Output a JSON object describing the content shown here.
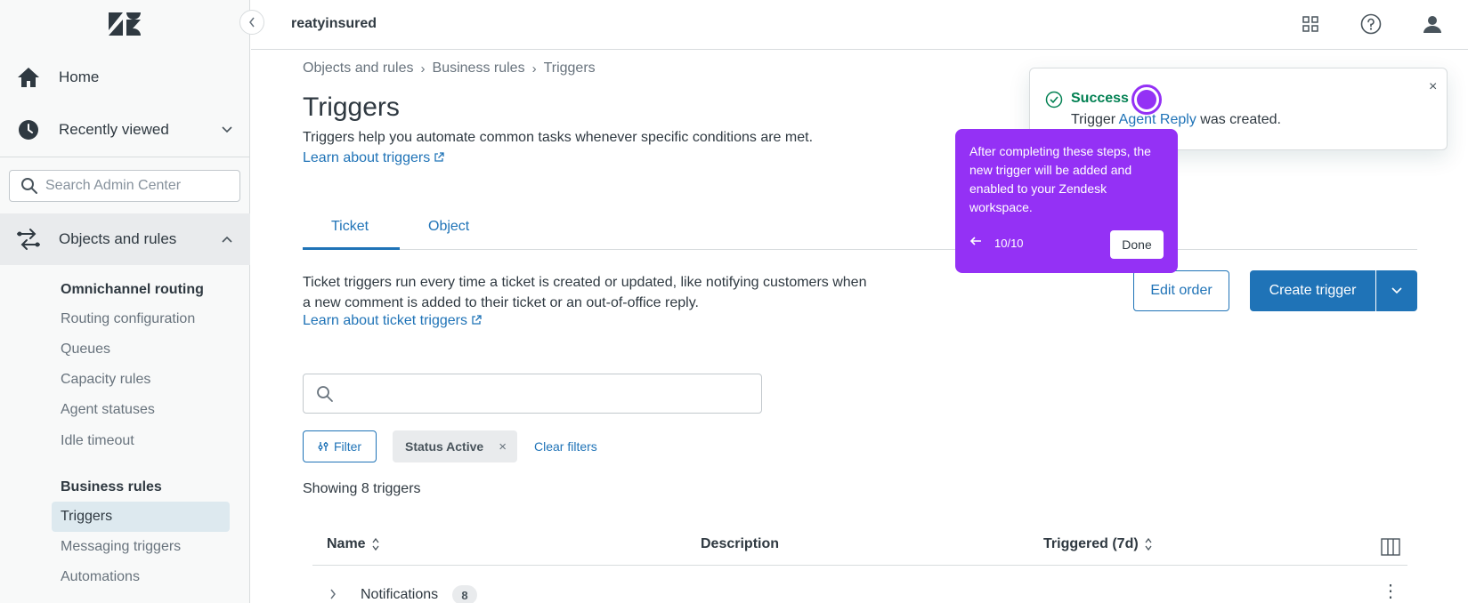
{
  "header": {
    "account_name": "reatyinsured"
  },
  "sidebar": {
    "home_label": "Home",
    "recently_viewed_label": "Recently viewed",
    "search_placeholder": "Search Admin Center",
    "objects_rules_label": "Objects and rules",
    "sections": [
      {
        "heading": "Omnichannel routing",
        "items": [
          "Routing configuration",
          "Queues",
          "Capacity rules",
          "Agent statuses",
          "Idle timeout"
        ]
      },
      {
        "heading": "Business rules",
        "items": [
          "Triggers",
          "Messaging triggers",
          "Automations"
        ]
      }
    ],
    "active_item": "Triggers"
  },
  "breadcrumb": [
    "Objects and rules",
    "Business rules",
    "Triggers"
  ],
  "page": {
    "title": "Triggers",
    "description": "Triggers help you automate common tasks whenever specific conditions are met.",
    "learn_link": "Learn about triggers"
  },
  "tabs": [
    {
      "label": "Ticket",
      "active": true
    },
    {
      "label": "Object",
      "active": false
    }
  ],
  "ticket_tab": {
    "description": "Ticket triggers run every time a ticket is created or updated, like notifying customers when a new comment is added to their ticket or an out-of-office reply.",
    "learn_link": "Learn about ticket triggers",
    "edit_order_label": "Edit order",
    "create_trigger_label": "Create trigger",
    "search_value": "",
    "filter_label": "Filter",
    "active_chip_label": "Status Active",
    "clear_filters_label": "Clear filters",
    "showing_text": "Showing 8 triggers"
  },
  "table": {
    "columns": [
      "Name",
      "Description",
      "Triggered (7d)"
    ],
    "rows": [
      {
        "name": "Notifications",
        "count": "8"
      }
    ]
  },
  "toast": {
    "title": "Success",
    "message_prefix": "Trigger",
    "message_link": "Agent Reply",
    "message_suffix": "was created."
  },
  "tour": {
    "text": "After completing these steps, the new trigger will be added and enabled to your Zendesk workspace.",
    "step": "10/10",
    "done_label": "Done"
  },
  "colors": {
    "accent": "#1f73b7",
    "tour": "#9431f5",
    "success": "#038153"
  }
}
